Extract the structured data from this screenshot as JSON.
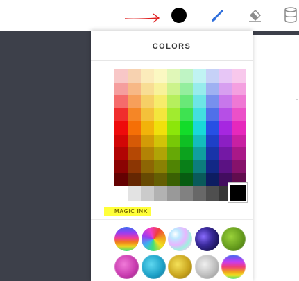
{
  "toolbar": {
    "tools": [
      {
        "name": "color",
        "icon": "color-dot-icon",
        "color": "#000000",
        "active": true
      },
      {
        "name": "brush",
        "icon": "brush-icon",
        "color": "#2f6fdc"
      },
      {
        "name": "eraser",
        "icon": "eraser-icon",
        "color": "#8c8c8c"
      },
      {
        "name": "fill",
        "icon": "paint-bucket-icon",
        "color": "#8c8c8c"
      }
    ],
    "annotation": {
      "type": "arrow",
      "color": "#e02020"
    }
  },
  "panel": {
    "title": "COLORS",
    "palette_columns": [
      [
        "#f8c7c7",
        "#f59e9e",
        "#f56b6b",
        "#f02d2d",
        "#ee0b0b",
        "#d20606",
        "#b10404",
        "#8b0303",
        "#640202"
      ],
      [
        "#f7d2b0",
        "#f7b886",
        "#f79f5a",
        "#f58626",
        "#f56f06",
        "#d65a06",
        "#b54804",
        "#8c3603",
        "#652702"
      ],
      [
        "#fbebbb",
        "#f8dd94",
        "#f6cf66",
        "#f4c13a",
        "#f2b30a",
        "#d39b07",
        "#b38305",
        "#8d6604",
        "#674a03"
      ],
      [
        "#fbf8c2",
        "#f8f29a",
        "#f6ec6b",
        "#f3e63d",
        "#f0e00c",
        "#d1c308",
        "#b0a406",
        "#8a8104",
        "#645e03"
      ],
      [
        "#e0f7b8",
        "#ccf38c",
        "#b6ef5d",
        "#a1eb2f",
        "#8ce60a",
        "#78c807",
        "#66a906",
        "#508404",
        "#3a6003"
      ],
      [
        "#bff4c4",
        "#94ee9e",
        "#69e878",
        "#3ee251",
        "#13dc2a",
        "#0fbf24",
        "#0ca21e",
        "#097f18",
        "#075c11"
      ],
      [
        "#c0f3f3",
        "#97ecec",
        "#6de5e5",
        "#43dfdf",
        "#19d8d8",
        "#14bcbc",
        "#109f9f",
        "#0c7d7d",
        "#095a5a"
      ],
      [
        "#c6d1f7",
        "#9fb1f2",
        "#7790ee",
        "#4f70e9",
        "#2750e4",
        "#1e40c7",
        "#1834a9",
        "#122886",
        "#0d1d61"
      ],
      [
        "#e7c6f6",
        "#d79ff0",
        "#c777eb",
        "#b64fe6",
        "#a627e0",
        "#8c1fc3",
        "#7418a5",
        "#5b1283",
        "#420d5f"
      ],
      [
        "#f8c8ec",
        "#f4a0e0",
        "#ef78d4",
        "#eb50c8",
        "#e628bc",
        "#c820a2",
        "#a91888",
        "#86126b",
        "#610d4e"
      ]
    ],
    "gray_row": [
      "#ffffff",
      "#e3e3e3",
      "#cbcbcb",
      "#b2b2b2",
      "#999999",
      "#818181",
      "#686868",
      "#4f4f4f",
      "#373737",
      "#000000"
    ],
    "selected_color": "#000000",
    "magic_label": "MAGIC INK",
    "magic_highlight_color": "#ffff3a",
    "magic_inks": [
      {
        "name": "rainbow",
        "icon": "rainbow-ink-icon"
      },
      {
        "name": "rainbow-swirl",
        "icon": "rainbow-swirl-ink-icon"
      },
      {
        "name": "holographic",
        "icon": "holographic-ink-icon"
      },
      {
        "name": "galaxy",
        "icon": "galaxy-ink-icon"
      },
      {
        "name": "green-glitter",
        "icon": "green-glitter-ink-icon"
      },
      {
        "name": "pink-glitter",
        "icon": "pink-glitter-ink-icon"
      },
      {
        "name": "teal-glitter",
        "icon": "teal-glitter-ink-icon"
      },
      {
        "name": "gold-glitter",
        "icon": "gold-glitter-ink-icon"
      },
      {
        "name": "silver-glitter",
        "icon": "silver-glitter-ink-icon"
      },
      {
        "name": "rainbow-glitter",
        "icon": "rainbow-glitter-ink-icon"
      }
    ]
  }
}
